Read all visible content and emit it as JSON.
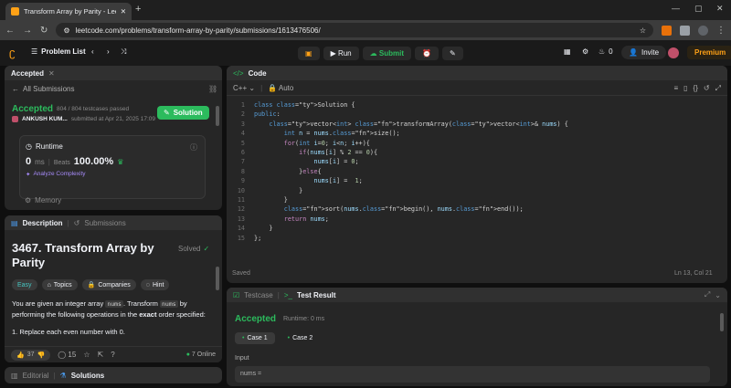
{
  "browser": {
    "tab_title": "Transform Array by Parity - Lee",
    "url": "leetcode.com/problems/transform-array-by-parity/submissions/1613476506/"
  },
  "topbar": {
    "problem_list": "Problem List",
    "run": "Run",
    "submit": "Submit",
    "streak_count": "0",
    "invite": "Invite",
    "premium": "Premium"
  },
  "submission": {
    "tab_label": "Accepted",
    "back_label": "All Submissions",
    "status": "Accepted",
    "testcases": "804 / 804 testcases passed",
    "user": "ANKUSH KUM...",
    "submitted": "submitted at Apr 21, 2025 17:09",
    "solution_btn": "Solution",
    "runtime_label": "Runtime",
    "runtime_value": "0",
    "runtime_unit": "ms",
    "beats_label": "Beats",
    "beats_value": "100.00%",
    "analyze": "Analyze Complexity",
    "memory_label": "Memory"
  },
  "description": {
    "tab_description": "Description",
    "tab_submissions": "Submissions",
    "title": "3467. Transform Array by Parity",
    "solved": "Solved",
    "tags": [
      "Easy",
      "Topics",
      "Companies",
      "Hint"
    ],
    "p1_a": "You are given an integer array",
    "p1_code1": "nums",
    "p1_b": ". Transform",
    "p1_code2": "nums",
    "p1_c": "by performing the following operations in the",
    "p1_bold": "exact",
    "p1_d": "order specified:",
    "step1": "1. Replace each even number with 0.",
    "likes": "37",
    "comments": "15",
    "online": "7 Online",
    "tab_editorial": "Editorial",
    "tab_solutions": "Solutions"
  },
  "code": {
    "header": "Code",
    "language": "C++",
    "mode": "Auto",
    "saved": "Saved",
    "position": "Ln 13, Col 21",
    "lines": [
      "class Solution {",
      "public:",
      "    vector<int> transformArray(vector<int>& nums) {",
      "        int n = nums.size();",
      "        for(int i=0; i<n; i++){",
      "            if(nums[i] % 2 == 0){",
      "                nums[i] = 0;",
      "            }else{",
      "                nums[i] =  1;",
      "            }",
      "        }",
      "        sort(nums.begin(), nums.end());",
      "        return nums;",
      "    }",
      "};"
    ]
  },
  "testpanel": {
    "tab_testcase": "Testcase",
    "tab_result": "Test Result",
    "status": "Accepted",
    "runtime": "Runtime: 0 ms",
    "case1": "Case 1",
    "case2": "Case 2",
    "input_label": "Input",
    "input_value": "nums ="
  },
  "colors": {
    "accent": "#ffa116",
    "green": "#2cbb5d",
    "bg": "#0f0f0f",
    "panel": "#262626"
  }
}
